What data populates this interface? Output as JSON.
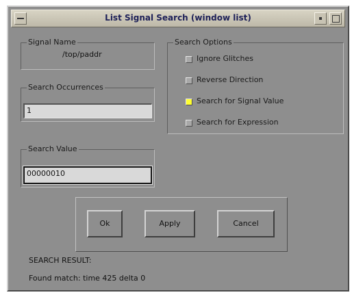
{
  "window": {
    "title": "List Signal Search (window list)"
  },
  "signal_name": {
    "legend": "Signal Name",
    "value": "/top/paddr"
  },
  "search_occurrences": {
    "legend": "Search Occurrences",
    "value": "1"
  },
  "search_value": {
    "legend": "Search Value",
    "value": "00000010"
  },
  "search_options": {
    "legend": "Search Options",
    "items": [
      {
        "label": "Ignore Glitches",
        "checked": false
      },
      {
        "label": "Reverse Direction",
        "checked": false
      },
      {
        "label": "Search for Signal Value",
        "checked": true
      },
      {
        "label": "Search for Expression",
        "checked": false
      }
    ]
  },
  "buttons": {
    "ok": "Ok",
    "apply": "Apply",
    "cancel": "Cancel"
  },
  "result": {
    "heading": "SEARCH RESULT:",
    "text": "Found match: time 425 delta 0"
  },
  "colors": {
    "dialog_bg": "#8e8e8e",
    "checked_indicator": "#ffff30",
    "title_text": "#1d2058"
  }
}
